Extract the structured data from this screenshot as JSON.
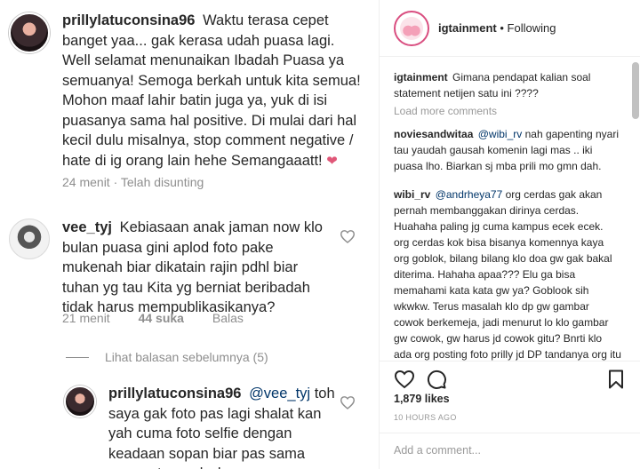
{
  "thread": {
    "main_comment": {
      "username": "prillylatuconsina96",
      "text": "Waktu terasa cepet banget yaa... gak kerasa udah puasa lagi. Well selamat menunaikan Ibadah Puasa ya semuanya! Semoga berkah untuk kita semua! Mohon maaf lahir batin juga ya, yuk di isi puasanya sama hal positive. Di mulai dari hal kecil dulu misalnya, stop comment negative / hate di ig orang lain hehe Semangaaatt!",
      "emoji": "❤",
      "meta": "24 menit · Telah disunting"
    },
    "reply": {
      "username": "vee_tyj",
      "text": "Kebiasaan anak jaman now klo bulan puasa gini aplod foto pake mukenah biar dikatain rajin pdhl biar tuhan yg tau Kita yg berniat beribadah tidak harus mempublikasikanya?",
      "time": "21 menit",
      "likes": "44 suka",
      "reply_label": "Balas"
    },
    "view_replies": "Lihat balasan sebelumnya (5)",
    "nested_reply": {
      "username": "prillylatuconsina96",
      "mention": "@vee_tyj",
      "text": "toh saya gak foto pas lagi shalat kan yah cuma foto selfie dengan keadaan sopan biar pas sama momentnya wkwk"
    }
  },
  "post": {
    "account": "igtainment",
    "separator": "•",
    "follow_status": "Following",
    "caption": {
      "username": "igtainment",
      "text": "Gimana pendapat kalian soal statement netijen satu ini ????"
    },
    "load_more": "Load more comments",
    "comments": [
      {
        "username": "noviesandwitaa",
        "mention": "@wibi_rv",
        "text": "nah gapenting nyari tau yaudah gausah komenin lagi mas .. iki puasa lho. Biarkan sj mba prili mo gmn dah."
      },
      {
        "username": "wibi_rv",
        "mention": "@andrheya77",
        "text": "org cerdas gak akan pernah membanggakan dirinya cerdas. Huahaha paling jg cuma kampus ecek ecek. org cerdas kok bisa bisanya komennya kaya org goblok, bilang bilang klo doa gw gak bakal diterima. Hahaha apaa??? Elu ga bisa memahami kata kata gw ya? Goblook sih wkwkw. Terus masalah klo dp gw gambar cowok berkemeja, jadi menurut lo klo gambar gw cowok, gw harus jd cowok gitu? Bnrti klo ada org posting foto prilly jd DP tandanya org itu harus jd prilly dong?"
      }
    ],
    "likes": "1,879 likes",
    "time_ago": "10 HOURS AGO",
    "add_comment_placeholder": "Add a comment..."
  },
  "colors": {
    "text": "#262626",
    "muted": "#8e8e8e",
    "mention": "#003569",
    "heart_emoji": "#e05778",
    "border": "#efefef"
  },
  "icons": [
    "heart-icon",
    "comment-icon",
    "bookmark-icon"
  ]
}
